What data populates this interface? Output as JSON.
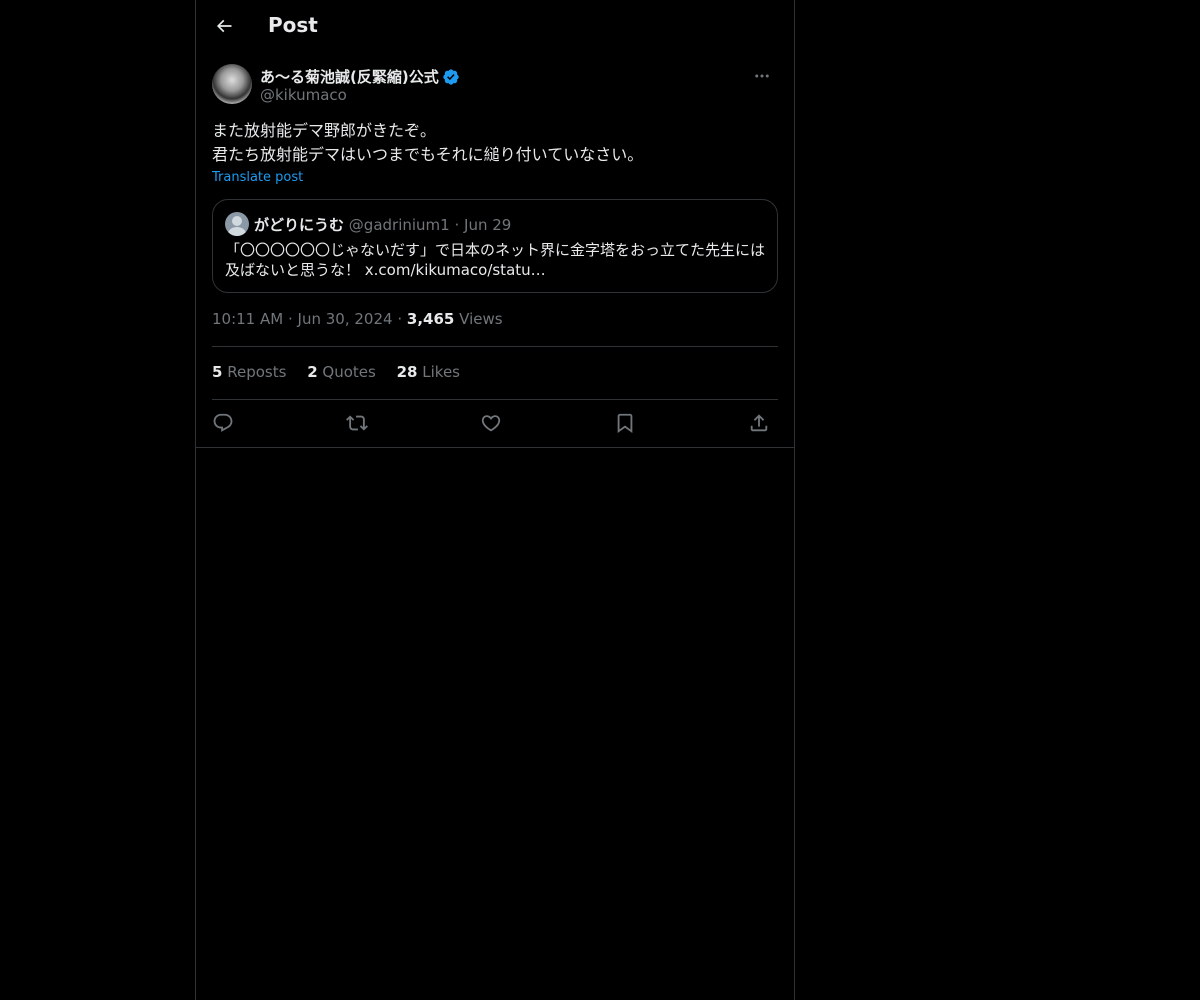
{
  "header": {
    "title": "Post",
    "back_icon": "arrow-left-icon"
  },
  "post": {
    "author_name": "あ〜る菊池誠(反緊縮)公式",
    "author_handle": "@kikumaco",
    "verified": true,
    "text_lines": [
      "また放射能デマ野郎がきたぞ。",
      "君たち放射能デマはいつまでもそれに縋り付いていなさい。"
    ],
    "translate_label": "Translate post",
    "time": "10:11 AM",
    "date": "Jun 30, 2024",
    "views_count": "3,465",
    "views_label": "Views",
    "separator": "·"
  },
  "quote": {
    "name": "がどりにうむ",
    "handle": "@gadrinium1",
    "date": "Jun 29",
    "text_lines": [
      "「〇〇〇〇〇〇じゃないだす」で日本のネット界に金字塔をおっ立てた先生には",
      "及ばないと思うな！ x.com/kikumaco/statu…"
    ]
  },
  "stats": {
    "reposts_count": "5",
    "reposts_label": "Reposts",
    "quotes_count": "2",
    "quotes_label": "Quotes",
    "likes_count": "28",
    "likes_label": "Likes"
  },
  "actions": [
    "reply-icon",
    "repost-icon",
    "like-icon",
    "bookmark-icon",
    "share-icon"
  ],
  "colors": {
    "background": "#000000",
    "text": "#e7e9ea",
    "muted": "#71767b",
    "accent": "#1d9bf0",
    "border": "#2f3336"
  }
}
